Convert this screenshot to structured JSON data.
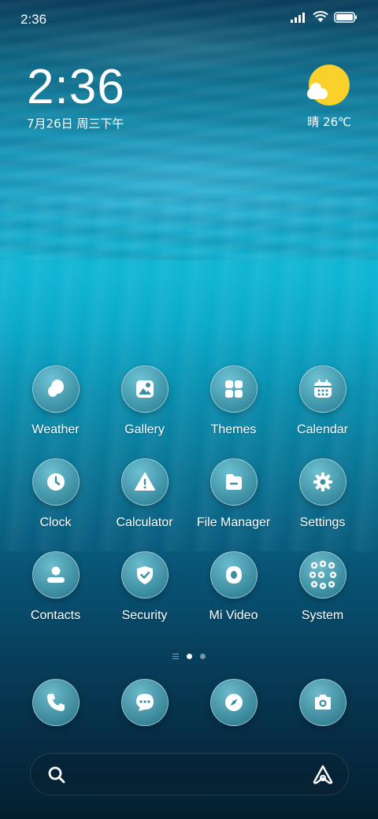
{
  "status_bar": {
    "time": "2:36",
    "icons": [
      "signal-icon",
      "wifi-icon",
      "battery-icon"
    ]
  },
  "clock_widget": {
    "time": "2:36",
    "date": "7月26日 周三下午"
  },
  "weather_widget": {
    "condition": "晴",
    "temperature": "26℃",
    "icon": "sun-cloud-icon"
  },
  "apps": [
    {
      "label": "Weather",
      "icon": "weather-icon"
    },
    {
      "label": "Gallery",
      "icon": "gallery-icon"
    },
    {
      "label": "Themes",
      "icon": "themes-icon"
    },
    {
      "label": "Calendar",
      "icon": "calendar-icon"
    },
    {
      "label": "Clock",
      "icon": "clock-icon"
    },
    {
      "label": "Calculator",
      "icon": "warning-icon"
    },
    {
      "label": "File Manager",
      "icon": "folder-icon"
    },
    {
      "label": "Settings",
      "icon": "gear-icon"
    },
    {
      "label": "Contacts",
      "icon": "person-icon"
    },
    {
      "label": "Security",
      "icon": "shield-icon"
    },
    {
      "label": "Mi Video",
      "icon": "play-icon"
    },
    {
      "label": "System",
      "icon": "folder-grid-icon"
    }
  ],
  "page_indicator": {
    "pages": 2,
    "current": 1
  },
  "dock": [
    {
      "icon": "phone-icon"
    },
    {
      "icon": "message-icon"
    },
    {
      "icon": "compass-icon"
    },
    {
      "icon": "camera-icon"
    }
  ],
  "search_bar": {
    "left_icon": "search-icon",
    "right_icon": "assistant-icon"
  },
  "colors": {
    "sun": "#f9d12a",
    "icon_fill": "#ffffff",
    "icon_bg": "#3a8fa0"
  }
}
